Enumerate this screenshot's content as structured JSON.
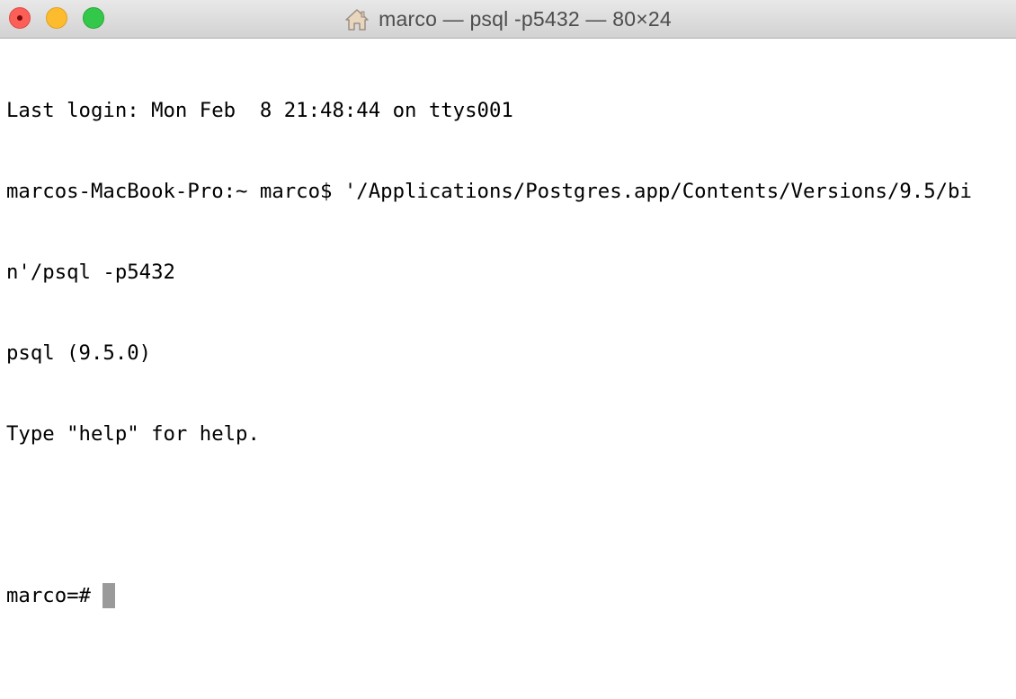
{
  "window": {
    "title": "marco — psql -p5432 — 80×24",
    "icon": "home-icon"
  },
  "terminal": {
    "lines": [
      "Last login: Mon Feb  8 21:48:44 on ttys001",
      "marcos-MacBook-Pro:~ marco$ '/Applications/Postgres.app/Contents/Versions/9.5/bi",
      "n'/psql -p5432",
      "psql (9.5.0)",
      "Type \"help\" for help.",
      ""
    ],
    "prompt": "marco=# "
  },
  "colors": {
    "close": "#fc5f57",
    "minimize": "#fdbc2e",
    "zoom": "#34c84a",
    "cursor": "#9a9a9a"
  }
}
